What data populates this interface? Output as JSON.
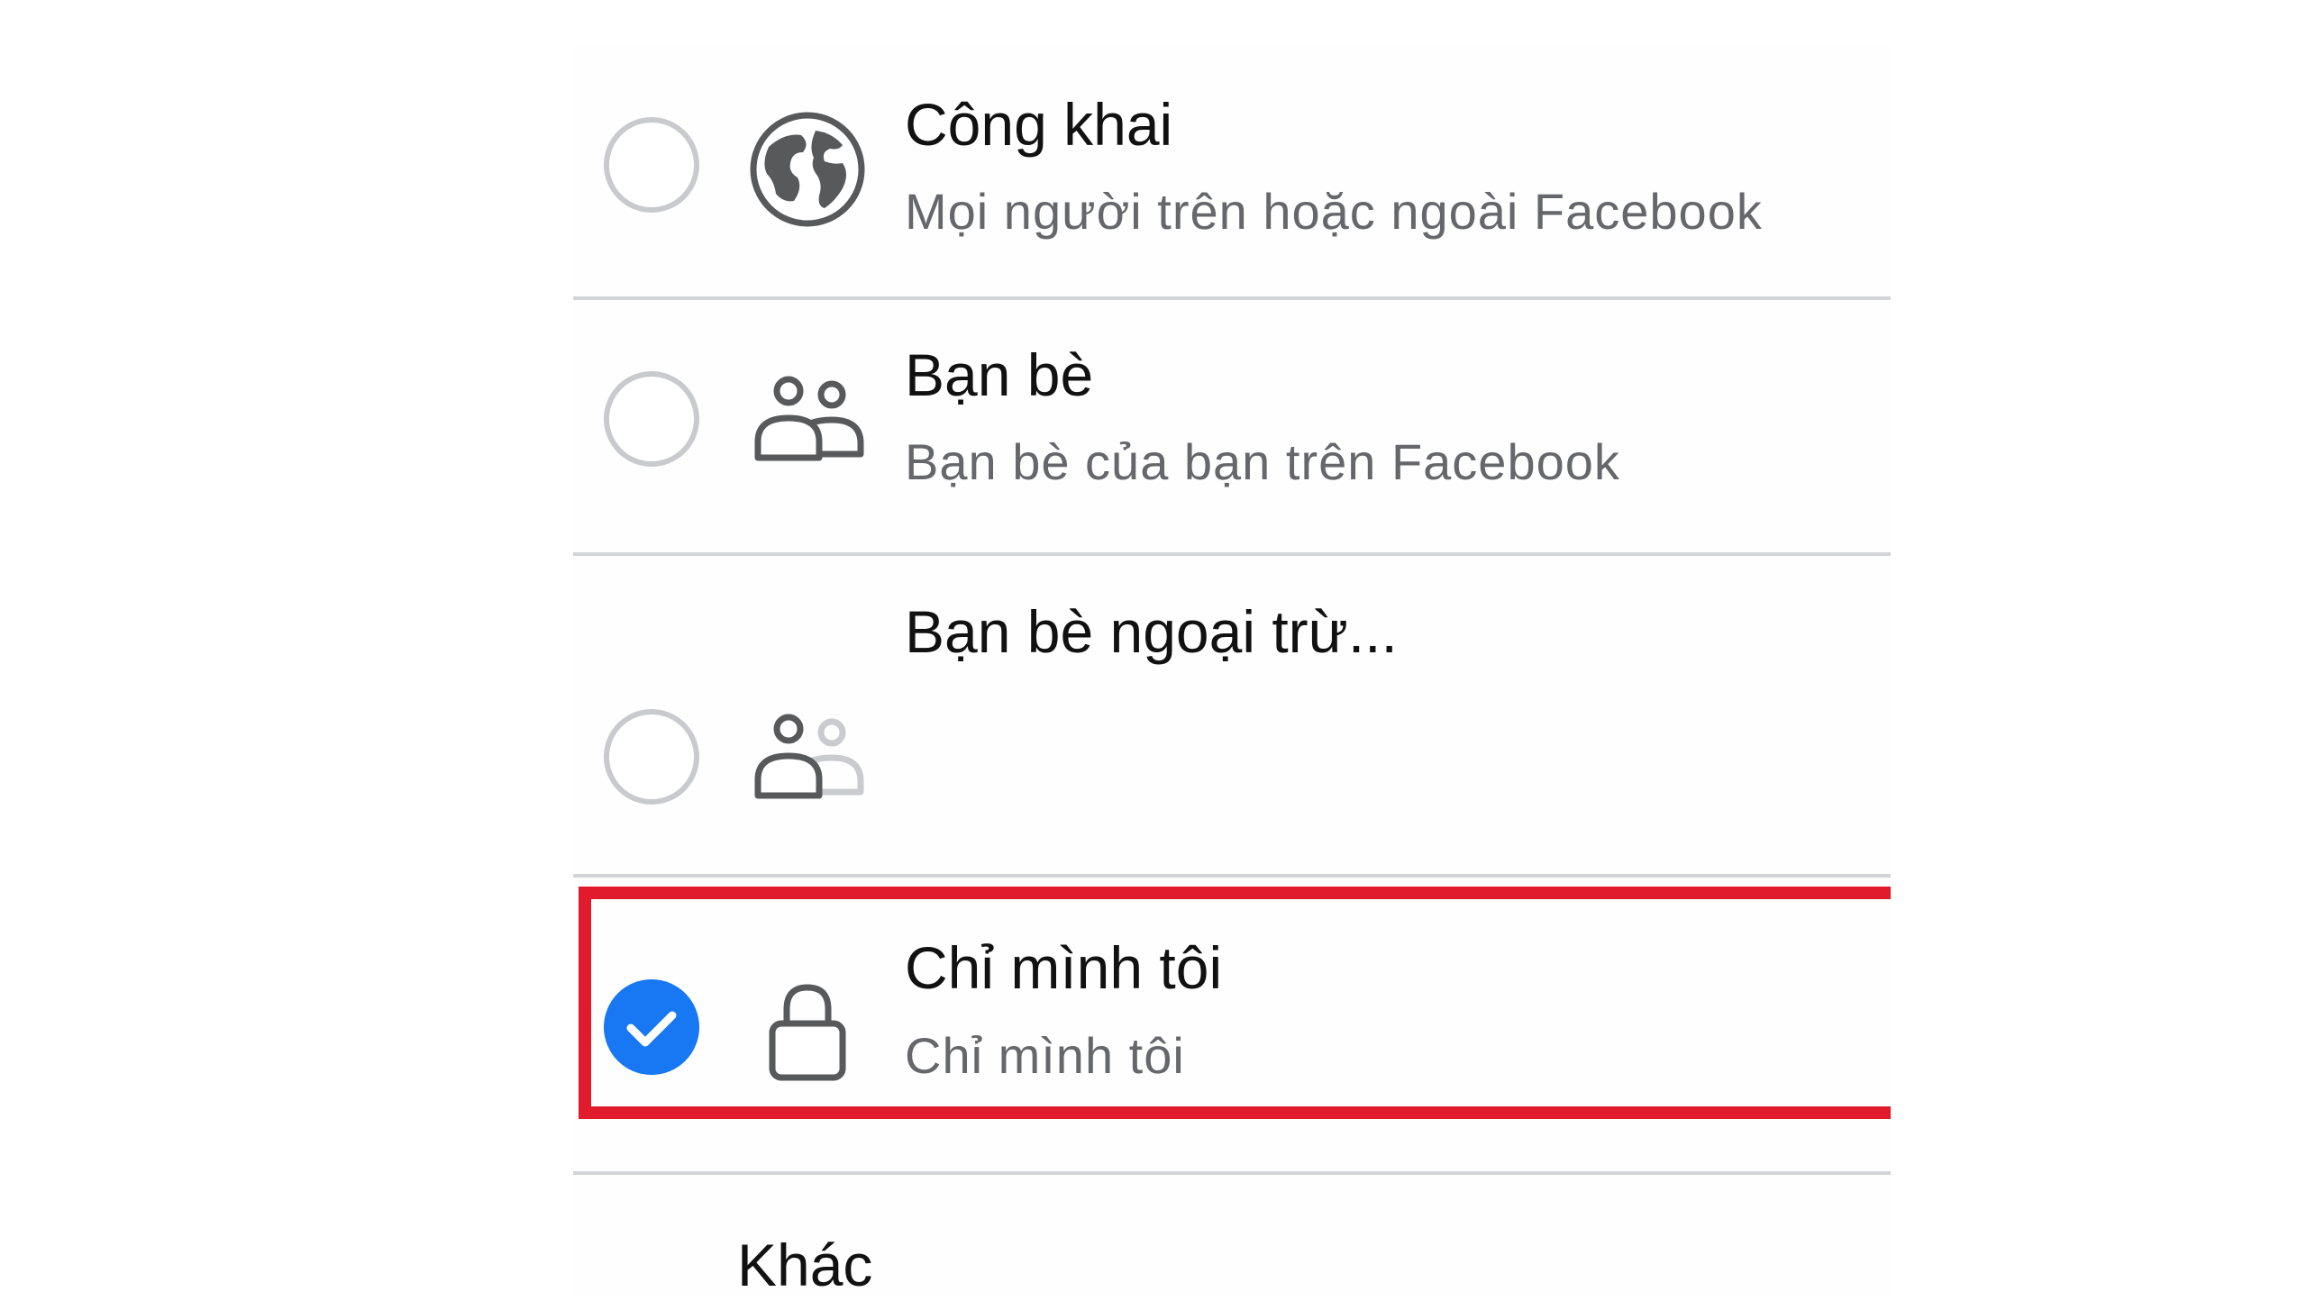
{
  "audience_options": [
    {
      "title": "Công khai",
      "subtitle": "Mọi người trên hoặc ngoài Facebook",
      "icon": "globe-icon",
      "selected": false
    },
    {
      "title": "Bạn bè",
      "subtitle": "Bạn bè của bạn trên Facebook",
      "icon": "friends-icon",
      "selected": false
    },
    {
      "title": "Bạn bè ngoại trừ...",
      "subtitle": "",
      "icon": "friends-except-icon",
      "selected": false
    },
    {
      "title": "Chỉ mình tôi",
      "subtitle": "Chỉ mình tôi",
      "icon": "lock-icon",
      "selected": true
    }
  ],
  "other": {
    "label": "Khác"
  },
  "colors": {
    "accent": "#1877f2",
    "highlight_border": "#e11b2b",
    "divider": "#d2d4d8",
    "subtitle_text": "#65676b",
    "radio_border": "#c8cacd",
    "icon_stroke": "#58595b"
  },
  "annotations": {
    "highlighted_option": "Chỉ mình tôi"
  }
}
